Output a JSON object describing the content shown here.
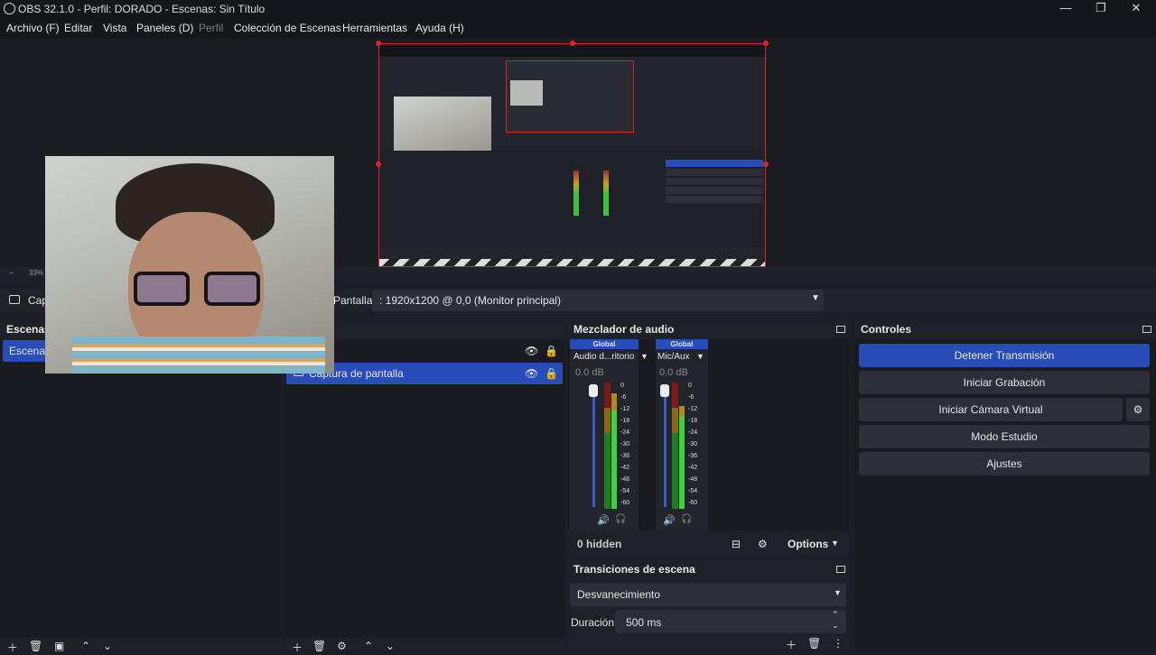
{
  "window": {
    "title": "OBS 32.1.0 - Perfil: DORADO - Escenas: Sin Título"
  },
  "menu": [
    {
      "label": "Archivo (F)",
      "disabled": false
    },
    {
      "label": "Editar",
      "disabled": false
    },
    {
      "label": "Vista",
      "disabled": false
    },
    {
      "label": "Paneles (D)",
      "disabled": false
    },
    {
      "label": "Perfil",
      "disabled": true
    },
    {
      "label": "Colección de Escenas",
      "disabled": false
    },
    {
      "label": "Herramientas",
      "disabled": false
    },
    {
      "label": "Ayuda (H)",
      "disabled": false
    }
  ],
  "preview": {
    "zoom": "33%"
  },
  "sourcebar": {
    "source_prefix": "Cap",
    "property_label": "Pantalla",
    "display_value": ": 1920x1200 @ 0,0 (Monitor principal)"
  },
  "scenes": {
    "title": "Escenas",
    "items": [
      "Escena"
    ]
  },
  "sources": {
    "items": [
      {
        "label": "",
        "visible": true,
        "locked": true
      },
      {
        "label": "Captura de pantalla",
        "visible": true,
        "locked": true
      }
    ]
  },
  "mixer": {
    "title": "Mezclador de audio",
    "channels": [
      {
        "scope": "Global",
        "name": "Audio d...ritorio",
        "db": "0.0 dB"
      },
      {
        "scope": "Global",
        "name": "Mic/Aux",
        "db": "0.0 dB"
      }
    ],
    "ticks": [
      "0",
      "-6",
      "-12",
      "-18",
      "-24",
      "-30",
      "-36",
      "-42",
      "-48",
      "-54",
      "-60"
    ],
    "hidden": "0 hidden",
    "options": "Options"
  },
  "controls": {
    "title": "Controles",
    "stop_stream": "Detener Transmisión",
    "start_record": "Iniciar Grabación",
    "virtual_cam": "Iniciar Cámara Virtual",
    "studio_mode": "Modo Estudio",
    "settings": "Ajustes"
  },
  "transitions": {
    "title": "Transiciones de escena",
    "selected": "Desvanecimiento",
    "duration_label": "Duración",
    "duration_value": "500 ms"
  },
  "colors": {
    "accent": "#284cb8",
    "selection_border": "#e0232a"
  }
}
